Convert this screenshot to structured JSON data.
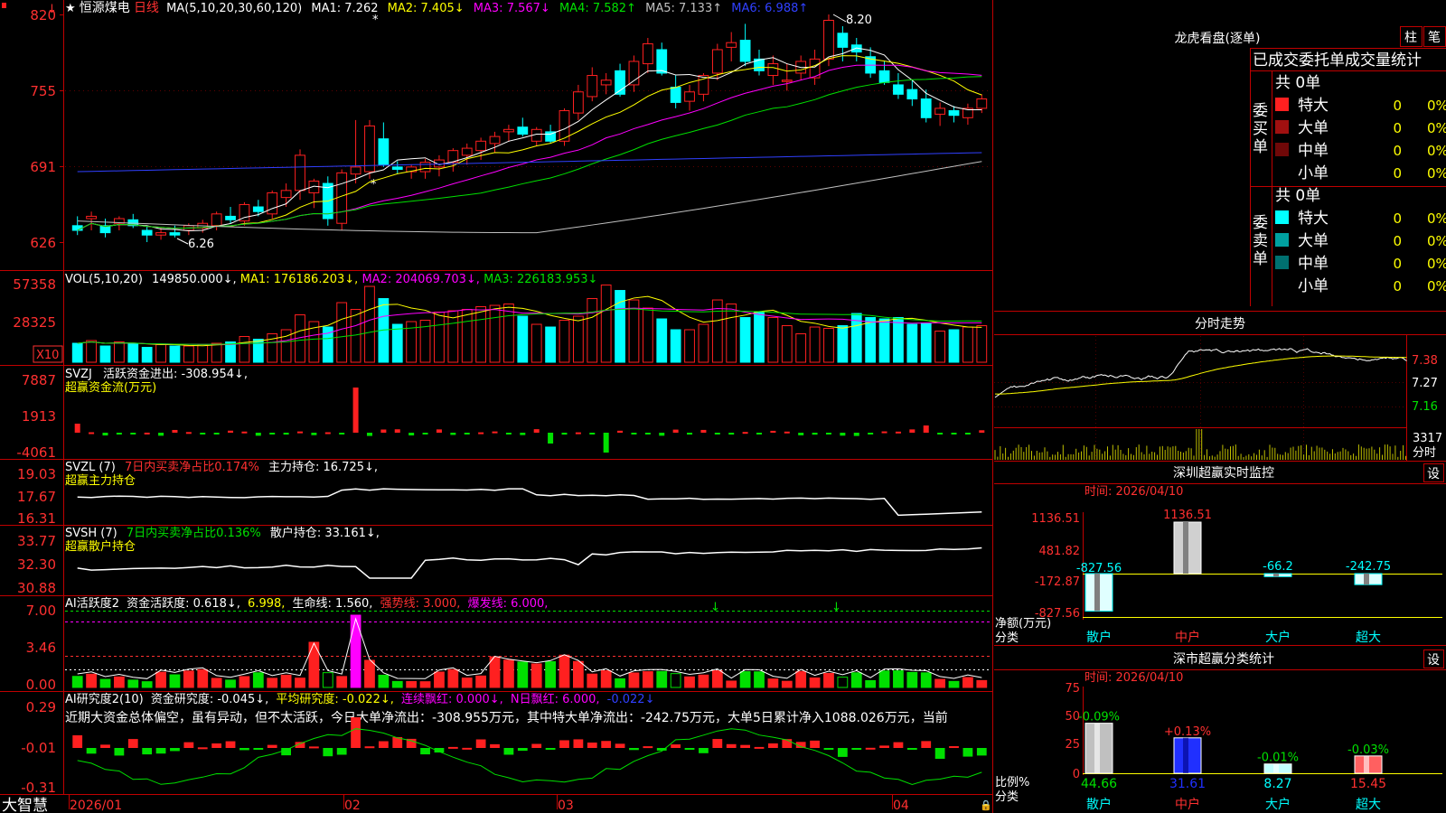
{
  "stock": {
    "name": "恒源煤电",
    "period": "日线",
    "icon_star": "★"
  },
  "ma_header": {
    "params": "MA(5,10,20,30,60,120)",
    "items": [
      {
        "label": "MA1: 7.262",
        "color": "#ffffff"
      },
      {
        "label": "MA2: 7.405↓",
        "color": "#ffff00"
      },
      {
        "label": "MA3: 7.567↓",
        "color": "#ff00ff"
      },
      {
        "label": "MA4: 7.582↑",
        "color": "#00e000"
      },
      {
        "label": "MA5: 7.133↑",
        "color": "#c0c0c0"
      },
      {
        "label": "MA6: 6.988↑",
        "color": "#3040ff"
      }
    ]
  },
  "price_axis": [
    "820",
    "755",
    "691",
    "626"
  ],
  "price_marks": {
    "high": "8.20",
    "low": "6.26"
  },
  "vol_header": {
    "params": "VOL(5,10,20)",
    "items": [
      {
        "label": "149850.000↓,",
        "color": "#ffffff"
      },
      {
        "label": "MA1: 176186.203↓,",
        "color": "#ffff00"
      },
      {
        "label": "MA2: 204069.703↓,",
        "color": "#ff00ff"
      },
      {
        "label": "MA3: 226183.953↓",
        "color": "#00e000"
      }
    ]
  },
  "vol_axis": [
    "57358",
    "28325"
  ],
  "vol_unit": "X10",
  "svzj": {
    "name": "SVZJ",
    "line1": "活跃资金进出: -308.954↓,",
    "line2": "超赢资金流(万元)",
    "axis": [
      "7887",
      "1913",
      "-4061"
    ]
  },
  "svzl": {
    "name": "SVZL (7)",
    "red": "7日内买卖净占比0.174%",
    "white": "主力持仓: 16.725↓,",
    "line2": "超赢主力持仓",
    "axis": [
      "19.03",
      "17.67",
      "16.31"
    ]
  },
  "svsh": {
    "name": "SVSH (7)",
    "green": "7日内买卖净占比0.136%",
    "white": "散户持仓: 33.161↓,",
    "line2": "超赢散户持仓",
    "axis": [
      "33.77",
      "32.30",
      "30.88"
    ]
  },
  "ai_active": {
    "name": "AI活跃度2",
    "items": [
      {
        "label": "资金活跃度: 0.618↓,",
        "color": "#ffffff"
      },
      {
        "label": "6.998,",
        "color": "#ffff00"
      },
      {
        "label": "生命线: 1.560,",
        "color": "#ffffff"
      },
      {
        "label": "强势线: 3.000,",
        "color": "#ff3030"
      },
      {
        "label": "爆发线: 6.000,",
        "color": "#ff00ff"
      }
    ],
    "axis": [
      "7.00",
      "3.46",
      "0.00"
    ]
  },
  "ai_research": {
    "name": "AI研究度2(10)",
    "items": [
      {
        "label": "资金研究度: -0.045↓,",
        "color": "#ffffff"
      },
      {
        "label": "平均研究度: -0.022↓,",
        "color": "#ffff00"
      },
      {
        "label": "连续飘红: 0.000↓,",
        "color": "#ff00ff"
      },
      {
        "label": "N日飘红: 6.000,",
        "color": "#ff00ff"
      },
      {
        "label": "-0.022↓",
        "color": "#3040ff"
      }
    ],
    "comment": "近期大资金总体偏空，虽有异动，但不太活跃，今日大单净流出：-308.955万元，其中特大单净流出：-242.75万元，大单5日累计净入1088.026万元，当前",
    "axis": [
      "0.29",
      "-0.01",
      "-0.31"
    ]
  },
  "time_axis": [
    "2026/01",
    "02",
    "03",
    "04"
  ],
  "brand": "大智慧",
  "chart_data": [
    {
      "type": "candlestick",
      "title": "恒源煤电 日线",
      "y_range": [
        626,
        820
      ],
      "ohlc": [
        [
          640,
          648,
          632,
          636
        ],
        [
          646,
          652,
          636,
          648
        ],
        [
          640,
          646,
          630,
          634
        ],
        [
          642,
          648,
          636,
          646
        ],
        [
          645,
          650,
          638,
          640
        ],
        [
          636,
          640,
          626,
          632
        ],
        [
          632,
          638,
          628,
          634
        ],
        [
          634,
          640,
          630,
          632
        ],
        [
          636,
          642,
          632,
          640
        ],
        [
          638,
          645,
          634,
          642
        ],
        [
          640,
          652,
          636,
          650
        ],
        [
          648,
          656,
          642,
          645
        ],
        [
          644,
          660,
          640,
          658
        ],
        [
          656,
          662,
          648,
          652
        ],
        [
          650,
          670,
          646,
          668
        ],
        [
          664,
          676,
          656,
          670
        ],
        [
          670,
          705,
          662,
          700
        ],
        [
          668,
          680,
          655,
          678
        ],
        [
          676,
          682,
          640,
          646
        ],
        [
          642,
          688,
          636,
          685
        ],
        [
          684,
          730,
          676,
          690
        ],
        [
          686,
          730,
          680,
          725
        ],
        [
          714,
          728,
          690,
          692
        ],
        [
          690,
          695,
          684,
          688
        ],
        [
          686,
          692,
          680,
          690
        ],
        [
          686,
          697,
          680,
          694
        ],
        [
          690,
          700,
          682,
          696
        ],
        [
          694,
          706,
          686,
          704
        ],
        [
          700,
          710,
          692,
          706
        ],
        [
          704,
          715,
          696,
          712
        ],
        [
          710,
          720,
          702,
          716
        ],
        [
          720,
          726,
          712,
          722
        ],
        [
          724,
          732,
          716,
          718
        ],
        [
          712,
          724,
          708,
          722
        ],
        [
          720,
          726,
          710,
          712
        ],
        [
          712,
          740,
          708,
          738
        ],
        [
          736,
          760,
          730,
          754
        ],
        [
          750,
          775,
          746,
          768
        ],
        [
          760,
          770,
          752,
          764
        ],
        [
          772,
          778,
          750,
          752
        ],
        [
          760,
          785,
          754,
          780
        ],
        [
          778,
          800,
          770,
          795
        ],
        [
          790,
          796,
          768,
          770
        ],
        [
          758,
          768,
          740,
          745
        ],
        [
          746,
          760,
          738,
          754
        ],
        [
          752,
          770,
          746,
          768
        ],
        [
          770,
          795,
          764,
          790
        ],
        [
          792,
          805,
          780,
          796
        ],
        [
          798,
          812,
          776,
          780
        ],
        [
          782,
          790,
          768,
          772
        ],
        [
          768,
          785,
          760,
          778
        ],
        [
          764,
          778,
          755,
          764
        ],
        [
          770,
          785,
          764,
          780
        ],
        [
          766,
          790,
          760,
          782
        ],
        [
          782,
          820,
          776,
          815
        ],
        [
          804,
          810,
          780,
          792
        ],
        [
          794,
          800,
          780,
          788
        ],
        [
          784,
          792,
          766,
          770
        ],
        [
          772,
          780,
          760,
          762
        ],
        [
          760,
          770,
          748,
          752
        ],
        [
          756,
          764,
          742,
          748
        ],
        [
          748,
          756,
          728,
          732
        ],
        [
          735,
          745,
          725,
          740
        ],
        [
          738,
          742,
          728,
          734
        ],
        [
          732,
          744,
          726,
          740
        ],
        [
          740,
          752,
          736,
          748
        ]
      ],
      "volume": [
        14000,
        16000,
        12000,
        15000,
        14000,
        11000,
        13000,
        12000,
        12000,
        13000,
        14000,
        15000,
        19000,
        17000,
        21000,
        24000,
        35000,
        30000,
        26000,
        44000,
        39000,
        56000,
        47000,
        28000,
        30000,
        31000,
        37000,
        38000,
        39000,
        41000,
        42000,
        43000,
        34000,
        28000,
        26000,
        31000,
        34000,
        47000,
        57000,
        53000,
        46000,
        40000,
        32000,
        24000,
        24000,
        28000,
        46000,
        43000,
        33000,
        37000,
        33000,
        27000,
        21000,
        26000,
        25000,
        27000,
        36000,
        33000,
        32000,
        33000,
        28000,
        29000,
        23000,
        24000,
        26000,
        27000
      ]
    },
    {
      "type": "bar",
      "title": "深圳超赢实时监控",
      "date": "时间: 2026/04/10",
      "categories": [
        "散户",
        "中户",
        "大户",
        "超大"
      ],
      "values": [
        -827.56,
        1136.51,
        -66.2,
        -242.75
      ],
      "axis": [
        "1136.51",
        "481.82",
        "-172.87",
        "-827.56"
      ],
      "label_row": [
        "净额(万元)",
        "分类"
      ]
    },
    {
      "type": "bar",
      "title": "深市超赢分类统计",
      "date": "时间: 2026/04/10",
      "categories": [
        "散户",
        "中户",
        "大户",
        "超大"
      ],
      "values": [
        44.66,
        31.61,
        8.27,
        15.45
      ],
      "changes": [
        "-0.09%",
        "+0.13%",
        "-0.01%",
        "-0.03%"
      ],
      "ylim": [
        0,
        75
      ],
      "axis": [
        "75",
        "50",
        "25",
        "0"
      ],
      "label_row": [
        "比例%",
        "分类"
      ]
    }
  ],
  "dragon": {
    "title": "龙虎看盘(逐单)",
    "tabs": [
      "柱",
      "笔"
    ],
    "subtitle": "已成交委托单成交量统计",
    "buy": {
      "label": "委买单",
      "total": "共 0单",
      "rows": [
        {
          "name": "特大",
          "n": "0",
          "pct": "0%",
          "color": "#ff2020"
        },
        {
          "name": "大单",
          "n": "0",
          "pct": "0%",
          "color": "#a01010"
        },
        {
          "name": "中单",
          "n": "0",
          "pct": "0%",
          "color": "#700808"
        },
        {
          "name": "小单",
          "n": "0",
          "pct": "0%",
          "color": "#000000"
        }
      ]
    },
    "sell": {
      "label": "委卖单",
      "total": "共 0单",
      "rows": [
        {
          "name": "特大",
          "n": "0",
          "pct": "0%",
          "color": "#00ffff"
        },
        {
          "name": "大单",
          "n": "0",
          "pct": "0%",
          "color": "#00a0a0"
        },
        {
          "name": "中单",
          "n": "0",
          "pct": "0%",
          "color": "#007070"
        },
        {
          "name": "小单",
          "n": "0",
          "pct": "0%",
          "color": "#000000"
        }
      ]
    }
  },
  "intraday": {
    "title": "分时走势",
    "axis": [
      "7.38",
      "7.27",
      "7.16"
    ],
    "vol_label": "3317",
    "vol_unit": "分时"
  },
  "settings_label": "设",
  "colors": {
    "up": "#ff2020",
    "down": "#00ffff",
    "grid": "#c00000"
  }
}
